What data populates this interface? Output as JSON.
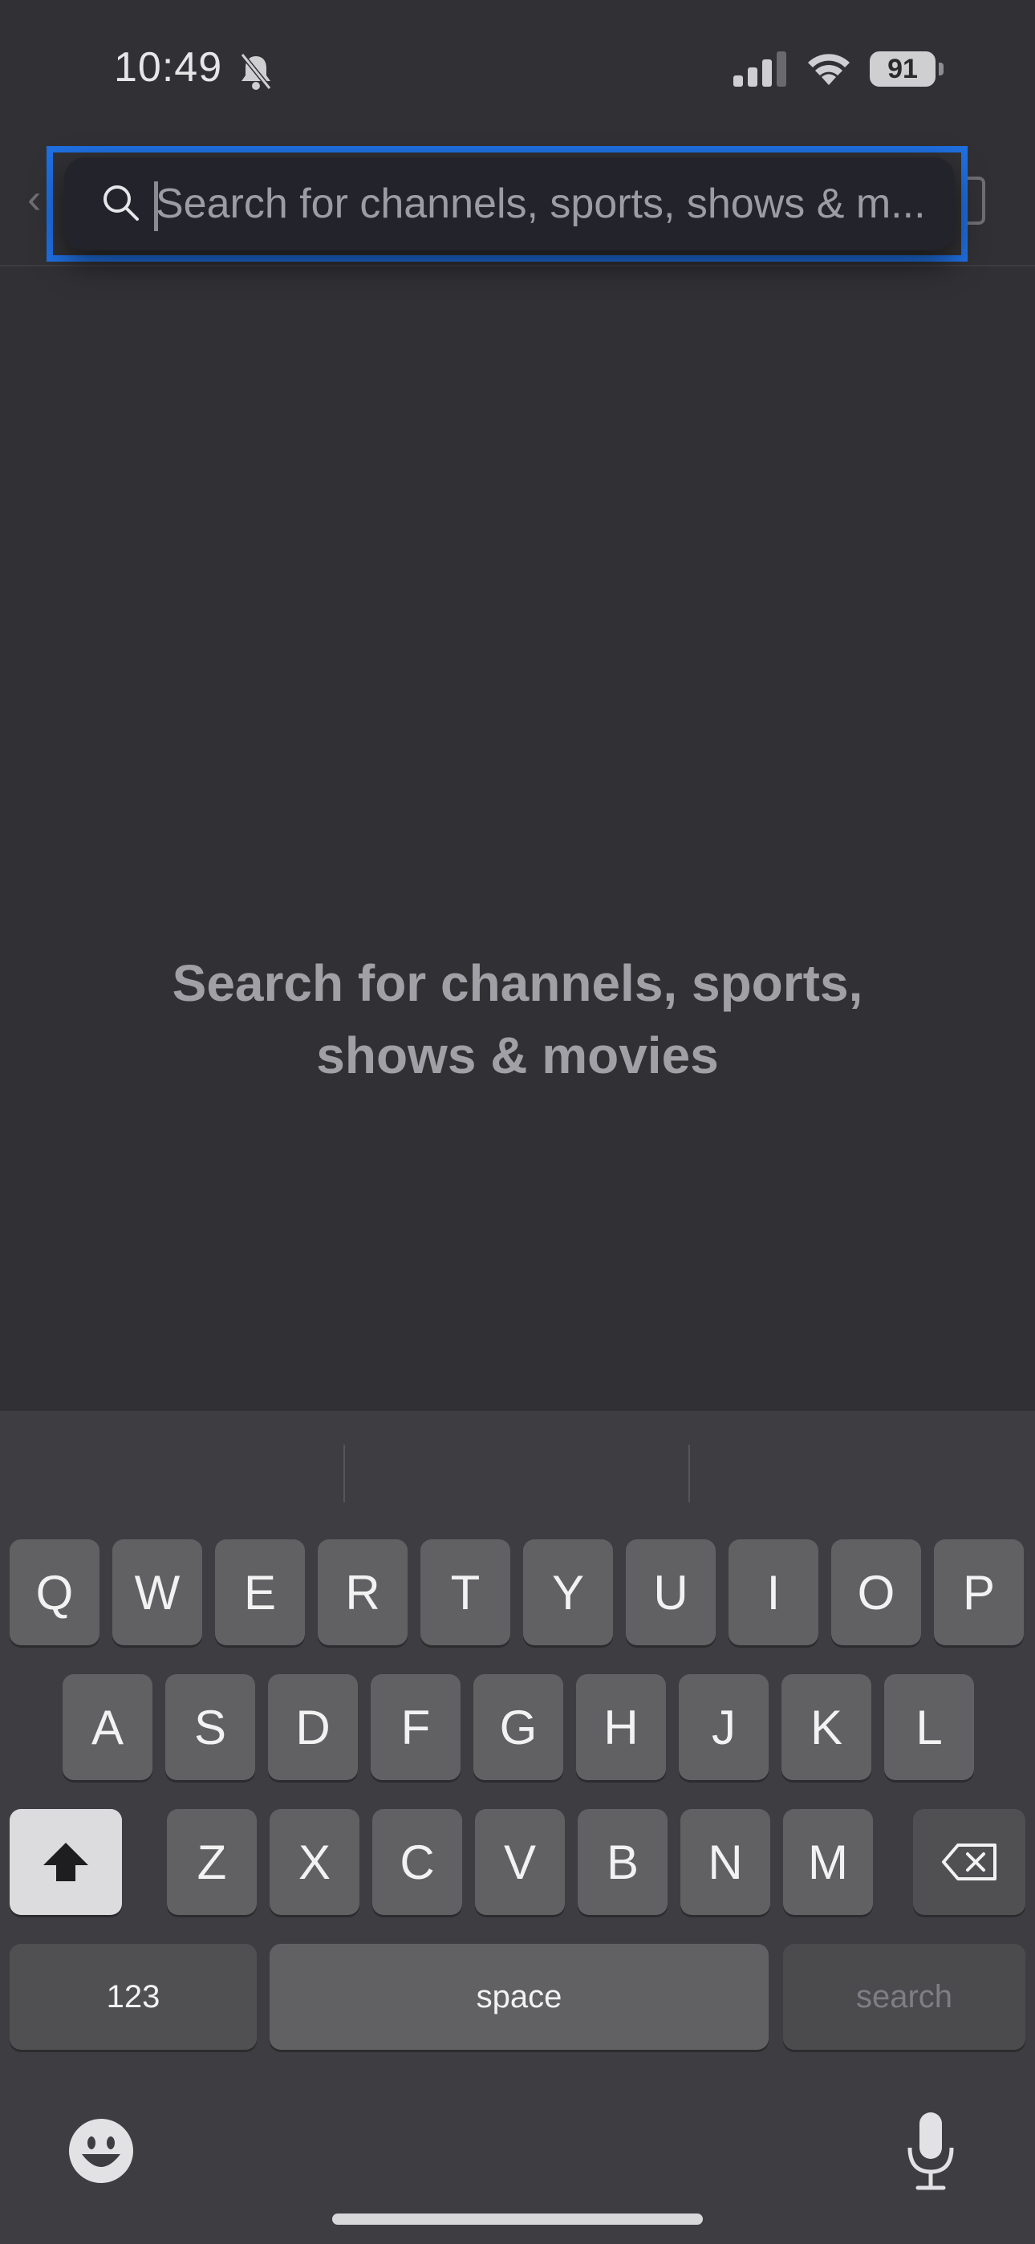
{
  "status_bar": {
    "time": "10:49",
    "battery": "91",
    "icons": [
      "bell-slash-icon",
      "cellular-signal-icon",
      "wifi-icon",
      "battery-icon"
    ]
  },
  "search": {
    "placeholder": "Search for channels, sports, shows & m...",
    "value": ""
  },
  "empty_state": {
    "line1": "Search for channels, sports,",
    "line2": "shows & movies"
  },
  "keyboard": {
    "row1": [
      "Q",
      "W",
      "E",
      "R",
      "T",
      "Y",
      "U",
      "I",
      "O",
      "P"
    ],
    "row2": [
      "A",
      "S",
      "D",
      "F",
      "G",
      "H",
      "J",
      "K",
      "L"
    ],
    "row3": [
      "Z",
      "X",
      "C",
      "V",
      "B",
      "N",
      "M"
    ],
    "numbers_label": "123",
    "space_label": "space",
    "search_label": "search"
  },
  "colors": {
    "background": "#313135",
    "highlight": "#1f6fe0",
    "keyboard": "#3e3e42"
  }
}
